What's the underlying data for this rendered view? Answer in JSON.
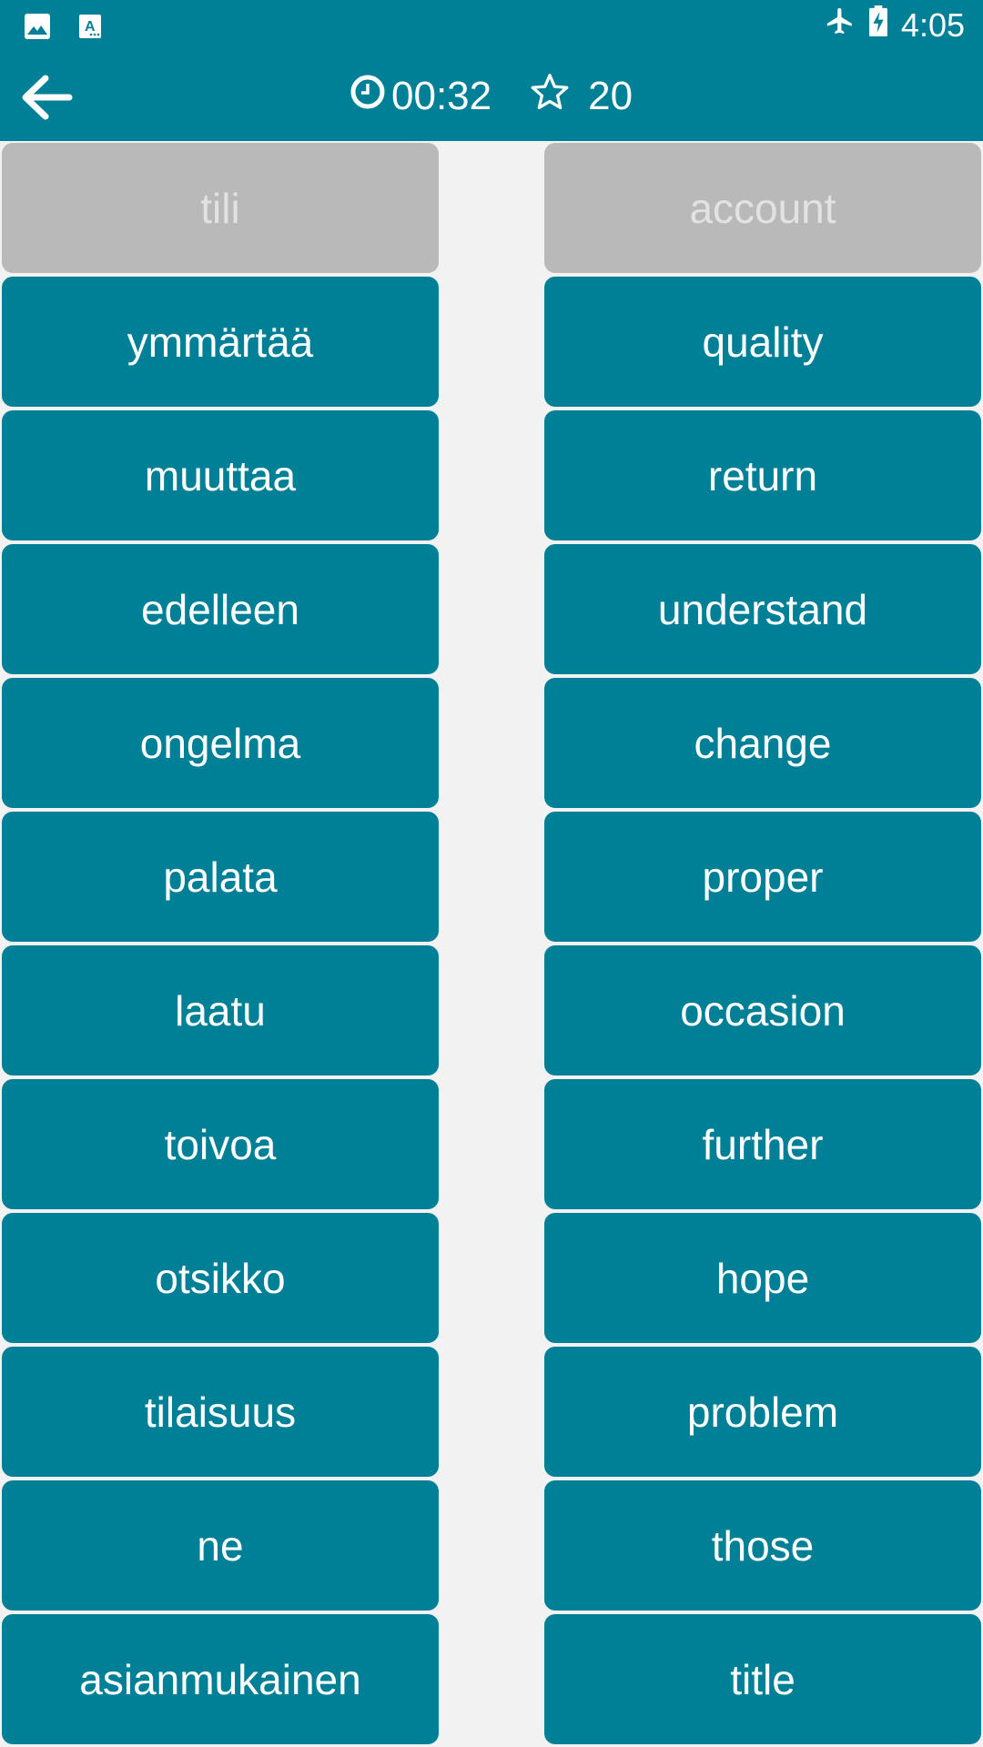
{
  "status_bar": {
    "left_icons": [
      "image-icon",
      "font-icon"
    ],
    "right_icons": [
      "airplane-icon",
      "battery-charging-icon"
    ],
    "time": "4:05"
  },
  "app_bar": {
    "back_icon": "arrow-left-icon",
    "timer": "00:32",
    "score": "20"
  },
  "colors": {
    "primary": "#008096",
    "matched_bg": "#b9b9b9",
    "matched_text": "#e2e2e2",
    "background": "#f2f2f2"
  },
  "pairs_left": [
    {
      "word": "tili",
      "matched": true
    },
    {
      "word": "ymmärtää",
      "matched": false
    },
    {
      "word": "muuttaa",
      "matched": false
    },
    {
      "word": "edelleen",
      "matched": false
    },
    {
      "word": "ongelma",
      "matched": false
    },
    {
      "word": "palata",
      "matched": false
    },
    {
      "word": "laatu",
      "matched": false
    },
    {
      "word": "toivoa",
      "matched": false
    },
    {
      "word": "otsikko",
      "matched": false
    },
    {
      "word": "tilaisuus",
      "matched": false
    },
    {
      "word": "ne",
      "matched": false
    },
    {
      "word": "asianmukainen",
      "matched": false
    }
  ],
  "pairs_right": [
    {
      "word": "account",
      "matched": true
    },
    {
      "word": "quality",
      "matched": false
    },
    {
      "word": "return",
      "matched": false
    },
    {
      "word": "understand",
      "matched": false
    },
    {
      "word": "change",
      "matched": false
    },
    {
      "word": "proper",
      "matched": false
    },
    {
      "word": "occasion",
      "matched": false
    },
    {
      "word": "further",
      "matched": false
    },
    {
      "word": "hope",
      "matched": false
    },
    {
      "word": "problem",
      "matched": false
    },
    {
      "word": "those",
      "matched": false
    },
    {
      "word": "title",
      "matched": false
    }
  ]
}
